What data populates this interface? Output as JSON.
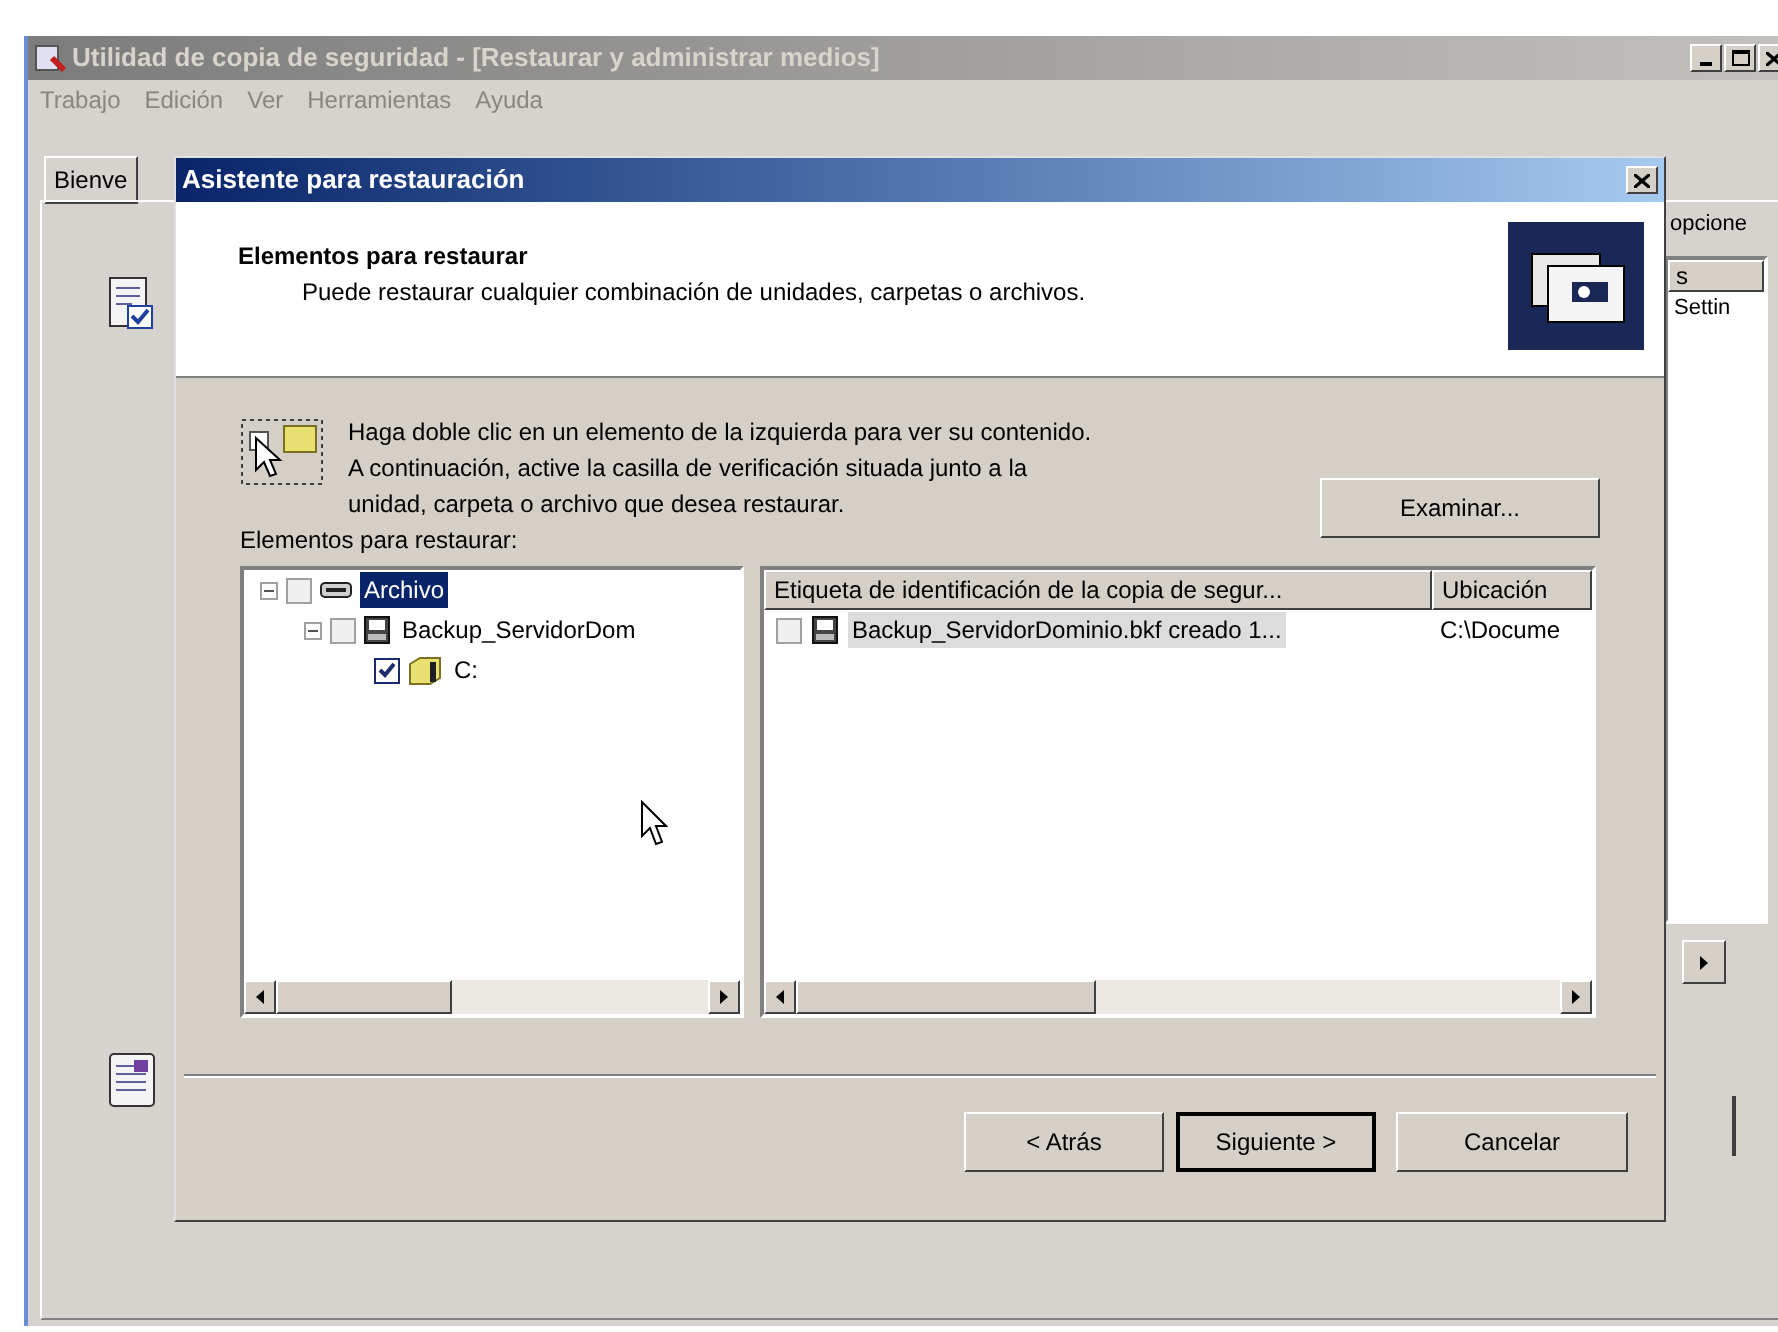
{
  "main_window": {
    "title": "Utilidad de copia de seguridad - [Restaurar y administrar medios]",
    "menu": [
      "Trabajo",
      "Edición",
      "Ver",
      "Herramientas",
      "Ayuda"
    ],
    "tab_label": "Bienve",
    "right_label": "opcione",
    "right_column_header": "s",
    "right_list_item": "Settin"
  },
  "dialog": {
    "title": "Asistente para restauración",
    "header_title": "Elementos para restaurar",
    "header_subtitle": "Puede restaurar cualquier combinación de unidades, carpetas o archivos.",
    "instructions": [
      "Haga doble clic en un elemento de la izquierda para ver su contenido.",
      "A continuación, active la casilla de verificación situada junto a la",
      "unidad, carpeta o archivo que desea restaurar."
    ],
    "browse_button": "Examinar...",
    "tree_label": "Elementos para restaurar:",
    "tree": [
      {
        "label": "Archivo",
        "kind": "media",
        "checked": false,
        "selected": true,
        "expanded": true,
        "children": [
          {
            "label": "Backup_ServidorDom",
            "kind": "backup",
            "checked": false,
            "selected": false,
            "expanded": true,
            "children": [
              {
                "label": "C:",
                "kind": "drive",
                "checked": true,
                "selected": false
              }
            ]
          }
        ]
      }
    ],
    "list": {
      "columns": [
        "Etiqueta de identificación de la copia de segur...",
        "Ubicación"
      ],
      "rows": [
        {
          "cells": [
            "Backup_ServidorDominio.bkf creado 1...",
            "C:\\Docume"
          ],
          "checked": false,
          "selected": true
        }
      ]
    },
    "buttons": [
      {
        "label": "< Atrás",
        "default": false
      },
      {
        "label": "Siguiente >",
        "default": true
      },
      {
        "label": "Cancelar",
        "default": false
      }
    ]
  }
}
